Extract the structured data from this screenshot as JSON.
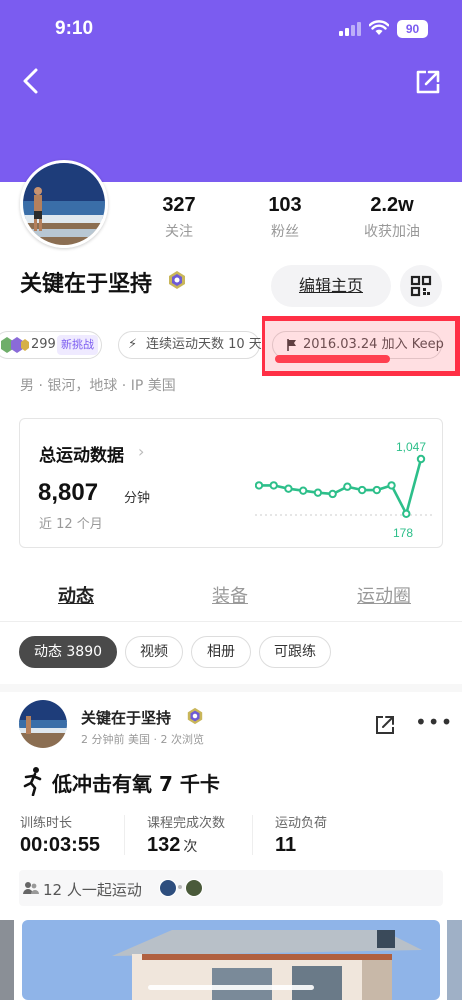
{
  "status_bar": {
    "time": "9:10",
    "battery": "90"
  },
  "profile": {
    "name": "关键在于坚持",
    "stats": [
      {
        "value": "327",
        "label": "关注"
      },
      {
        "value": "103",
        "label": "粉丝"
      },
      {
        "value": "2.2w",
        "label": "收获加油"
      }
    ],
    "edit_label": "编辑主页",
    "chips": {
      "challenge_count": "299",
      "challenge_tag": "新挑战",
      "streak": "连续运动天数 10 天",
      "joined": "2016.03.24 加入 Keep"
    },
    "location": "男 · 银河，地球 · IP 美国"
  },
  "sport_summary": {
    "title": "总运动数据",
    "value": "8,807",
    "unit": "分钟",
    "period": "近 12 个月",
    "max_label": "1,047",
    "min_label": "178"
  },
  "chart_data": {
    "type": "line",
    "points": [
      0.6,
      0.6,
      0.55,
      0.52,
      0.49,
      0.47,
      0.58,
      0.53,
      0.53,
      0.6,
      0.17,
      1.0
    ],
    "max": 1047,
    "min": 178,
    "color": "#2dbf8a"
  },
  "tabs": [
    "动态",
    "装备",
    "运动圈"
  ],
  "filters": [
    "动态 3890",
    "视频",
    "相册",
    "可跟练"
  ],
  "post": {
    "author": "关键在于坚持",
    "meta": "2 分钟前 美国 · 2 次浏览",
    "workout": "低冲击有氧  7  千卡",
    "metrics": [
      {
        "label": "训练时长",
        "value": "00:03:55",
        "unit": ""
      },
      {
        "label": "课程完成次数",
        "value": "132",
        "unit": "次"
      },
      {
        "label": "运动负荷",
        "value": "11",
        "unit": ""
      }
    ],
    "together": "12  人一起运动"
  },
  "colors": {
    "header": "#7b5cf0",
    "accent_green": "#2dbf8a",
    "highlight": "#ff2f45"
  }
}
